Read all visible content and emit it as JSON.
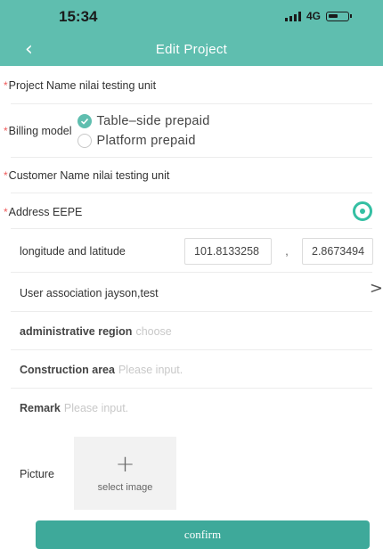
{
  "status_bar": {
    "time": "15:34",
    "network": "4G"
  },
  "nav": {
    "title": "Edit Project"
  },
  "form": {
    "project_name": {
      "label": "Project Name",
      "value": "nilai testing unit"
    },
    "billing_model": {
      "label": "Billing model",
      "options": [
        {
          "label": "Table–side prepaid",
          "selected": true
        },
        {
          "label": "Platform prepaid",
          "selected": false
        }
      ]
    },
    "customer_name": {
      "label": "Customer Name",
      "value": "nilai testing unit"
    },
    "address": {
      "label": "Address",
      "value": "EEPE"
    },
    "coordinates": {
      "label": "longitude and latitude",
      "longitude": "101.8133258",
      "separator": ",",
      "latitude": "2.8673494"
    },
    "user_association": {
      "label": "User association",
      "value": "jayson,test"
    },
    "administrative_region": {
      "label": "administrative region",
      "placeholder": "choose"
    },
    "construction_area": {
      "label": "Construction area",
      "placeholder": "Please input."
    },
    "remark": {
      "label": "Remark",
      "placeholder": "Please input."
    },
    "picture": {
      "label": "Picture",
      "select_label": "select image"
    }
  },
  "confirm_label": "confirm",
  "colors": {
    "header": "#5fbeaf",
    "accent": "#34bfa3",
    "required": "#ef5a5a",
    "button": "#3ea99a"
  }
}
